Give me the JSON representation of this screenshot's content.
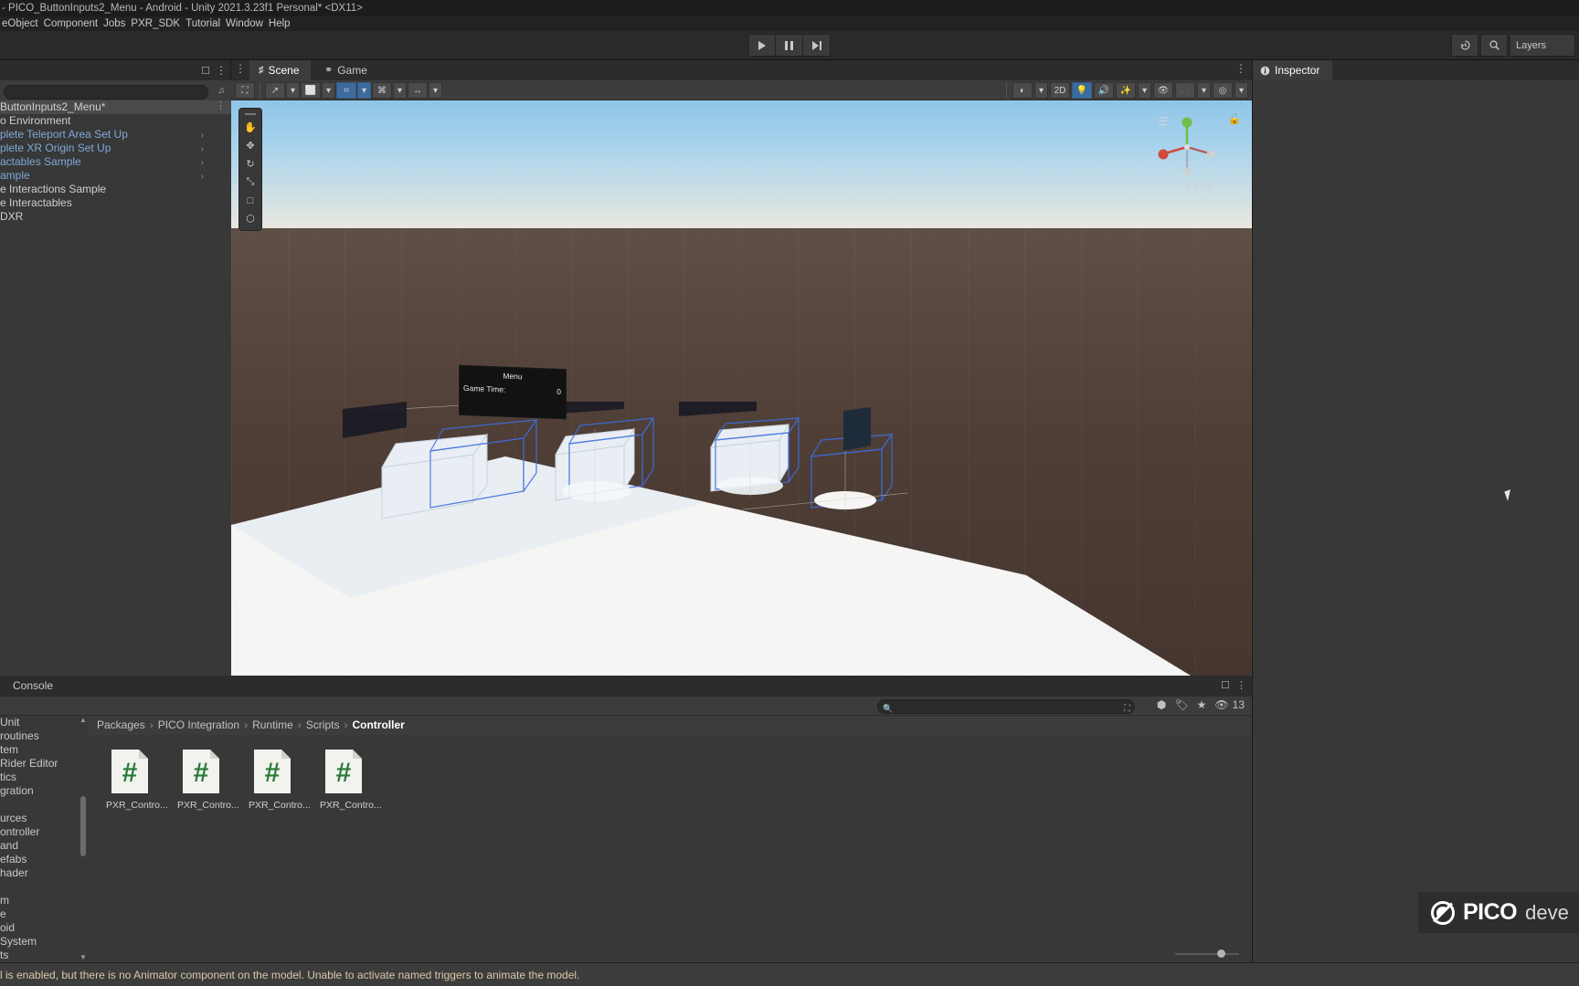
{
  "window": {
    "title": "- PICO_ButtonInputs2_Menu - Android - Unity 2021.3.23f1 Personal* <DX11>"
  },
  "menubar": {
    "items": [
      "eObject",
      "Component",
      "Jobs",
      "PXR_SDK",
      "Tutorial",
      "Window",
      "Help"
    ]
  },
  "toolbar": {
    "play_icon": "play-icon",
    "pause_icon": "pause-icon",
    "step_icon": "step-icon",
    "history_icon": "history-icon",
    "search_icon": "search-icon",
    "layers_label": "Layers"
  },
  "hierarchy": {
    "search_placeholder": "",
    "rows": [
      {
        "label": "ButtonInputs2_Menu*",
        "kind": "scene",
        "selected": true,
        "arrow": false,
        "dots": true
      },
      {
        "label": "o Environment",
        "kind": "scene",
        "selected": false,
        "arrow": false,
        "dots": false
      },
      {
        "label": "plete Teleport Area Set Up",
        "kind": "prefab",
        "selected": false,
        "arrow": true,
        "dots": false
      },
      {
        "label": "plete XR Origin Set Up",
        "kind": "prefab",
        "selected": false,
        "arrow": true,
        "dots": false
      },
      {
        "label": "actables Sample",
        "kind": "prefab",
        "selected": false,
        "arrow": true,
        "dots": false
      },
      {
        "label": "ample",
        "kind": "prefab",
        "selected": false,
        "arrow": true,
        "dots": false
      },
      {
        "label": "e Interactions Sample",
        "kind": "scene",
        "selected": false,
        "arrow": false,
        "dots": false
      },
      {
        "label": "e Interactables",
        "kind": "scene",
        "selected": false,
        "arrow": false,
        "dots": false
      },
      {
        "label": "DXR",
        "kind": "scene",
        "selected": false,
        "arrow": false,
        "dots": false
      }
    ]
  },
  "scene_panel": {
    "tabs": [
      {
        "label": "Scene",
        "icon": "grid-icon",
        "active": true
      },
      {
        "label": "Game",
        "icon": "gamepad-icon",
        "active": false
      }
    ],
    "tools": [
      {
        "name": "hand-tool",
        "glyph": "✋",
        "active": false
      },
      {
        "name": "move-tool",
        "glyph": "✥",
        "active": false
      },
      {
        "name": "rotate-tool",
        "glyph": "↻",
        "active": false
      },
      {
        "name": "scale-tool",
        "glyph": "⤡",
        "active": false
      },
      {
        "name": "rect-tool",
        "glyph": "□",
        "active": false
      },
      {
        "name": "transform-tool",
        "glyph": "⬡",
        "active": false
      }
    ],
    "toolbar_left": [
      {
        "name": "pivot-rotation-toggle",
        "glyph": "↗",
        "dropdown": true,
        "active": false
      },
      {
        "name": "pivot-center-toggle",
        "glyph": "⬜",
        "dropdown": true,
        "active": false
      },
      {
        "name": "grid-snapping-toggle",
        "glyph": "⌗",
        "dropdown": true,
        "active": true
      },
      {
        "name": "grid-visibility-toggle",
        "glyph": "⌘",
        "dropdown": true,
        "active": false
      },
      {
        "name": "scene-ruler-toggle",
        "glyph": "↔",
        "dropdown": true,
        "active": false
      }
    ],
    "toolbar_right": [
      {
        "name": "shading-mode-dropdown",
        "glyph": "◐",
        "dropdown": true,
        "active": false
      },
      {
        "name": "toggle-2d-button",
        "glyph": "2D",
        "dropdown": false,
        "active": false
      },
      {
        "name": "scene-lighting-toggle",
        "glyph": "💡",
        "dropdown": false,
        "active": true
      },
      {
        "name": "scene-audio-toggle",
        "glyph": "🔊",
        "dropdown": false,
        "active": false
      },
      {
        "name": "fx-dropdown",
        "glyph": "✨",
        "dropdown": true,
        "active": false
      },
      {
        "name": "scene-visibility-toggle",
        "glyph": "👁",
        "dropdown": false,
        "active": false
      },
      {
        "name": "camera-settings-dropdown",
        "glyph": "🎥",
        "dropdown": true,
        "active": false
      },
      {
        "name": "gizmos-dropdown",
        "glyph": "◎",
        "dropdown": true,
        "active": false
      }
    ],
    "gizmo_label": "Persp",
    "game_menu_overlay": {
      "title": "Menu",
      "row_label": "Game Time:",
      "row_value": "0"
    }
  },
  "inspector": {
    "tab_label": "Inspector",
    "tab_icon": "info-icon"
  },
  "console": {
    "tab_label": "Console"
  },
  "project": {
    "search_value": "",
    "search_placeholder": "",
    "breadcrumb": [
      "Packages",
      "PICO Integration",
      "Runtime",
      "Scripts",
      "Controller"
    ],
    "filter_icons": [
      {
        "name": "package-filter-icon",
        "glyph": "⬢"
      },
      {
        "name": "label-filter-icon",
        "glyph": "🏷"
      },
      {
        "name": "favorites-icon",
        "glyph": "★"
      },
      {
        "name": "hidden-packages-icon",
        "glyph": "👁"
      }
    ],
    "hidden_count": "13",
    "tree_rows": [
      {
        "label": "Unit",
        "selected": false
      },
      {
        "label": "routines",
        "selected": false
      },
      {
        "label": "tem",
        "selected": false
      },
      {
        "label": " Rider Editor",
        "selected": false
      },
      {
        "label": "tics",
        "selected": false
      },
      {
        "label": "gration",
        "selected": false
      },
      {
        "label": "",
        "selected": false
      },
      {
        "label": "urces",
        "selected": false
      },
      {
        "label": "ontroller",
        "selected": false
      },
      {
        "label": "and",
        "selected": false
      },
      {
        "label": "efabs",
        "selected": false
      },
      {
        "label": "hader",
        "selected": false
      },
      {
        "label": "",
        "selected": false
      },
      {
        "label": "m",
        "selected": false
      },
      {
        "label": "e",
        "selected": false
      },
      {
        "label": "oid",
        "selected": false
      },
      {
        "label": "System",
        "selected": false
      },
      {
        "label": "ts",
        "selected": false
      },
      {
        "label": "ontroller",
        "selected": true
      }
    ],
    "assets": [
      {
        "label": "PXR_Contro...",
        "icon": "csharp-script-icon"
      },
      {
        "label": "PXR_Contro...",
        "icon": "csharp-script-icon"
      },
      {
        "label": "PXR_Contro...",
        "icon": "csharp-script-icon"
      },
      {
        "label": "PXR_Contro...",
        "icon": "csharp-script-icon"
      }
    ]
  },
  "statusbar": {
    "message": "l is enabled, but there is no Animator component on the model. Unable to activate named triggers to animate the model."
  },
  "watermark": {
    "brand": "PICO",
    "suffix": "deve",
    "mark_icon": "pico-logo-icon"
  },
  "colors": {
    "accent_blue": "#3d6b9e",
    "panel_bg": "#383838",
    "tab_bg": "#2c2c2c",
    "warning_text": "#d8c9a8",
    "prefab_blue": "#7fa8d8",
    "script_green": "#2a7a3a"
  }
}
